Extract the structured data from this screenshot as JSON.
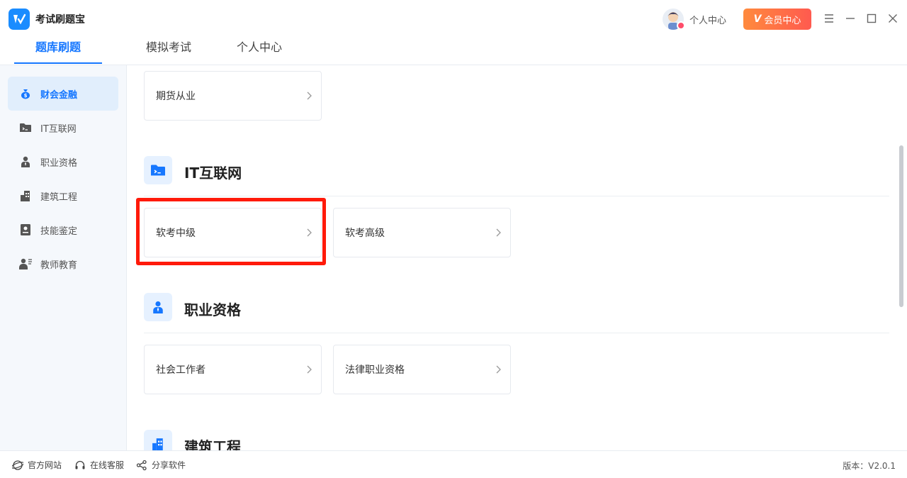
{
  "app": {
    "title": "考试刷题宝"
  },
  "header": {
    "user_label": "个人中心",
    "vip_v": "V",
    "vip_label": "会员中心"
  },
  "tabs": [
    {
      "label": "题库刷题",
      "active": true
    },
    {
      "label": "模拟考试",
      "active": false
    },
    {
      "label": "个人中心",
      "active": false
    }
  ],
  "sidebar": {
    "items": [
      {
        "label": "财会金融",
        "icon": "money-bag-icon",
        "active": true
      },
      {
        "label": "IT互联网",
        "icon": "terminal-folder-icon",
        "active": false
      },
      {
        "label": "职业资格",
        "icon": "person-tie-icon",
        "active": false
      },
      {
        "label": "建筑工程",
        "icon": "building-icon",
        "active": false
      },
      {
        "label": "技能鉴定",
        "icon": "certificate-icon",
        "active": false
      },
      {
        "label": "教师教育",
        "icon": "teacher-icon",
        "active": false
      }
    ]
  },
  "main": {
    "top_cards": [
      "期货从业"
    ],
    "sections": [
      {
        "title": "IT互联网",
        "icon": "terminal-folder-icon",
        "cards": [
          "软考中级",
          "软考高级"
        ]
      },
      {
        "title": "职业资格",
        "icon": "person-tie-icon",
        "cards": [
          "社会工作者",
          "法律职业资格"
        ]
      },
      {
        "title": "建筑工程",
        "icon": "building-icon",
        "cards": []
      }
    ]
  },
  "footer": {
    "links": [
      {
        "label": "官方网站",
        "icon": "globe-icon"
      },
      {
        "label": "在线客服",
        "icon": "headset-icon"
      },
      {
        "label": "分享软件",
        "icon": "share-icon"
      }
    ],
    "version": "版本：V2.0.1"
  },
  "colors": {
    "accent": "#1677ff",
    "highlight": "#ff1a0a",
    "vip": "#ff6a45"
  }
}
